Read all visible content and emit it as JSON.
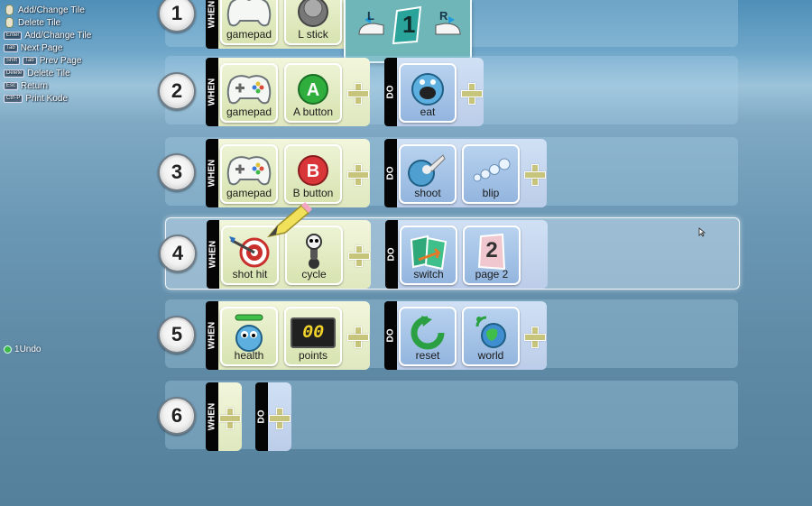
{
  "help": [
    {
      "keys": [],
      "mouse": "left",
      "text": "Add/Change Tile"
    },
    {
      "keys": [],
      "mouse": "right",
      "text": "Delete Tile"
    },
    {
      "keys": [
        "Enter"
      ],
      "text": "Add/Change Tile"
    },
    {
      "keys": [
        "Tab"
      ],
      "text": "Next Page"
    },
    {
      "keys": [
        "Shift",
        "Tab"
      ],
      "text": "Prev Page"
    },
    {
      "keys": [
        "Delete"
      ],
      "text": "Delete Tile"
    },
    {
      "keys": [
        "Esc"
      ],
      "text": "Return"
    },
    {
      "keys": [
        "Ctrl-P"
      ],
      "text": "Print Kode"
    }
  ],
  "undo": {
    "count": "1",
    "label": "Undo"
  },
  "page": {
    "left_key": "L",
    "right_key": "R",
    "number": "1"
  },
  "labels": {
    "when": "WHEN",
    "do": "DO"
  },
  "rules": [
    {
      "number": "1",
      "when": [
        {
          "label": "gamepad",
          "icon": "gamepad-icon"
        },
        {
          "label": "L stick",
          "icon": "l-stick-icon"
        }
      ],
      "do": [],
      "selected": false
    },
    {
      "number": "2",
      "when": [
        {
          "label": "gamepad",
          "icon": "gamepad-icon"
        },
        {
          "label": "A button",
          "icon": "a-button-icon"
        }
      ],
      "do": [
        {
          "label": "eat",
          "icon": "eat-icon"
        }
      ],
      "selected": false
    },
    {
      "number": "3",
      "when": [
        {
          "label": "gamepad",
          "icon": "gamepad-icon"
        },
        {
          "label": "B button",
          "icon": "b-button-icon"
        }
      ],
      "do": [
        {
          "label": "shoot",
          "icon": "shoot-icon"
        },
        {
          "label": "blip",
          "icon": "blip-icon"
        }
      ],
      "selected": false
    },
    {
      "number": "4",
      "when": [
        {
          "label": "shot hit",
          "icon": "target-icon"
        },
        {
          "label": "cycle",
          "icon": "cycle-icon"
        }
      ],
      "do": [
        {
          "label": "switch",
          "icon": "switch-icon"
        },
        {
          "label": "page 2",
          "icon": "page-2-icon",
          "page_digit": "2"
        }
      ],
      "selected": true
    },
    {
      "number": "5",
      "when": [
        {
          "label": "health",
          "icon": "health-icon"
        },
        {
          "label": "points",
          "icon": "points-icon",
          "display": "00"
        }
      ],
      "do": [
        {
          "label": "reset",
          "icon": "reset-icon"
        },
        {
          "label": "world",
          "icon": "world-icon"
        }
      ],
      "selected": false
    },
    {
      "number": "6",
      "when": [],
      "do": [],
      "selected": false
    }
  ],
  "colors": {
    "when_tile": "#dfe8bf",
    "do_tile": "#a9c4e7",
    "pager": "#6fb6b8",
    "plus": "#c7c47c",
    "points_digits": "#f2d32a"
  }
}
